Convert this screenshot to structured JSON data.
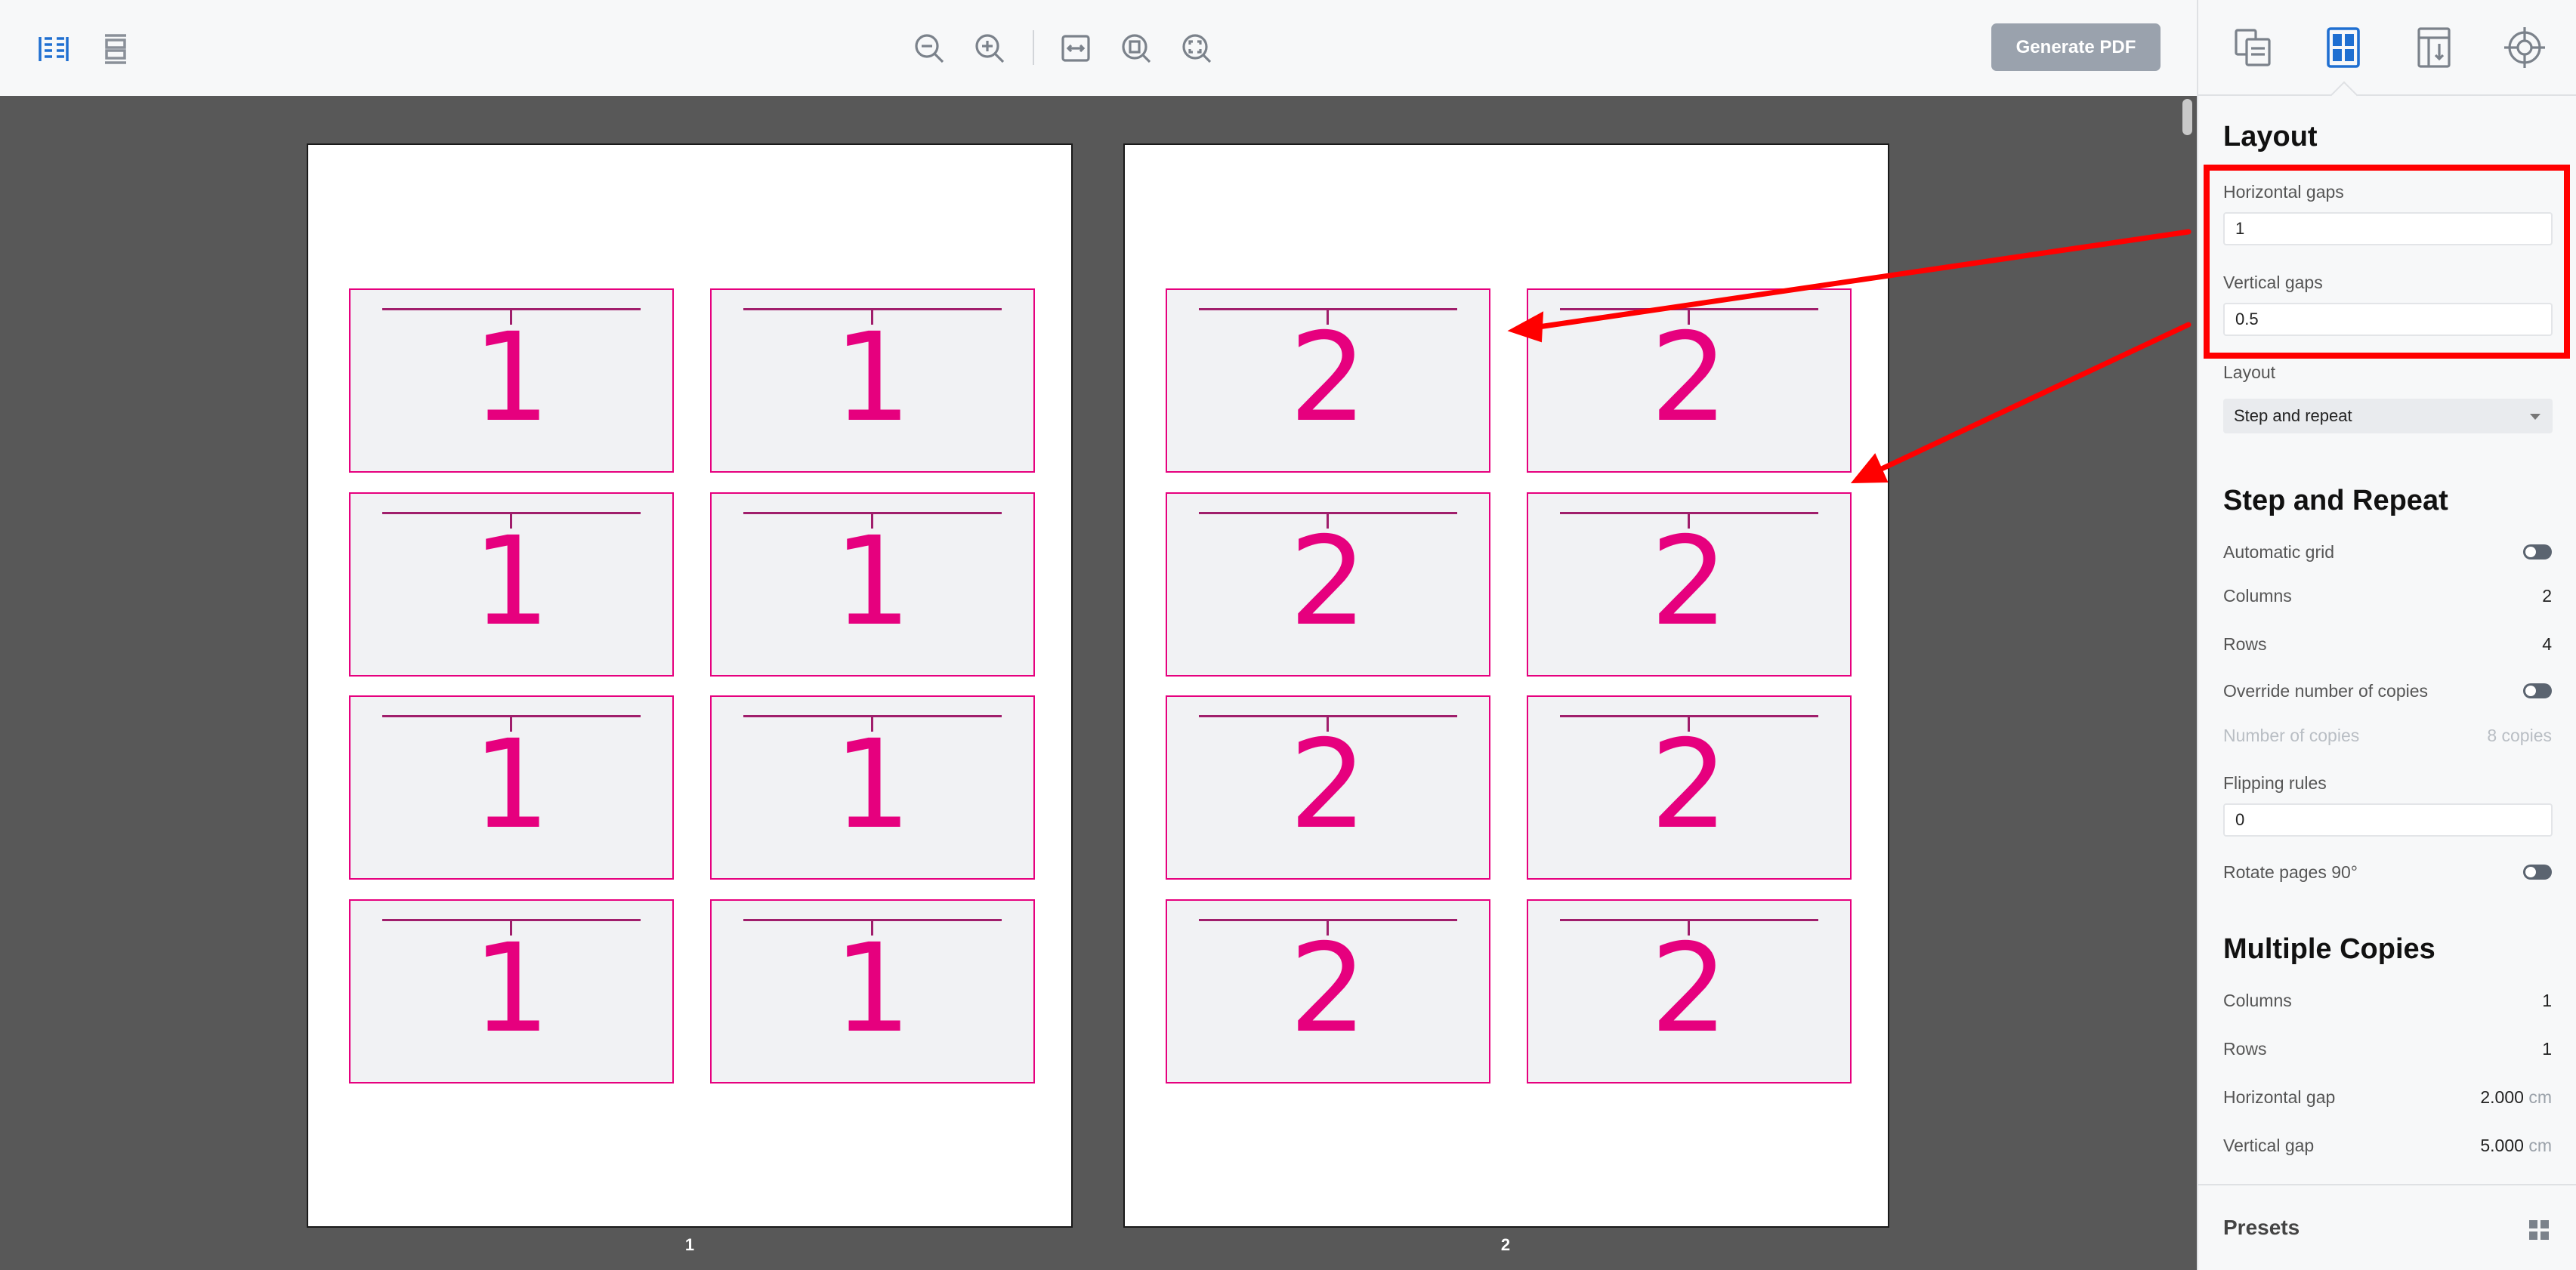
{
  "toolbar": {
    "icons": {
      "view_side_by_side": "two-page-view-icon",
      "view_single": "single-page-view-icon",
      "zoom_out": "zoom-out-icon",
      "zoom_in": "zoom-in-icon",
      "fit_width": "fit-width-icon",
      "fit_page": "fit-page-icon",
      "actual_size": "actual-size-icon"
    },
    "generate_label": "Generate PDF"
  },
  "preview": {
    "pages": [
      {
        "label": "1",
        "cards": [
          "1",
          "1",
          "1",
          "1",
          "1",
          "1",
          "1",
          "1"
        ]
      },
      {
        "label": "2",
        "cards": [
          "2",
          "2",
          "2",
          "2",
          "2",
          "2",
          "2",
          "2"
        ]
      }
    ]
  },
  "panel": {
    "tabs": [
      "pages-tab-icon",
      "layout-tab-icon",
      "marks-tab-icon",
      "registration-tab-icon"
    ],
    "active_tab": "layout",
    "layout": {
      "title": "Layout",
      "horizontal_gaps_label": "Horizontal gaps",
      "horizontal_gaps_value": "1",
      "vertical_gaps_label": "Vertical gaps",
      "vertical_gaps_value": "0.5",
      "layout_label": "Layout",
      "layout_value": "Step and repeat"
    },
    "step_repeat": {
      "title": "Step and Repeat",
      "automatic_grid_label": "Automatic grid",
      "columns_label": "Columns",
      "columns_value": "2",
      "rows_label": "Rows",
      "rows_value": "4",
      "override_label": "Override number of copies",
      "copies_label": "Number of copies",
      "copies_value": "8 copies",
      "flipping_label": "Flipping rules",
      "flipping_value": "0",
      "rotate_label": "Rotate pages 90°"
    },
    "multiple_copies": {
      "title": "Multiple Copies",
      "columns_label": "Columns",
      "columns_value": "1",
      "rows_label": "Rows",
      "rows_value": "1",
      "hgap_label": "Horizontal gap",
      "hgap_value": "2.000",
      "vgap_label": "Vertical gap",
      "vgap_value": "5.000",
      "unit": "cm"
    },
    "presets": {
      "title": "Presets",
      "icon": "grid-icon"
    }
  },
  "colors": {
    "accent": "#1f6fd1",
    "card_border": "#e6007e",
    "annotation": "#ff0000"
  }
}
